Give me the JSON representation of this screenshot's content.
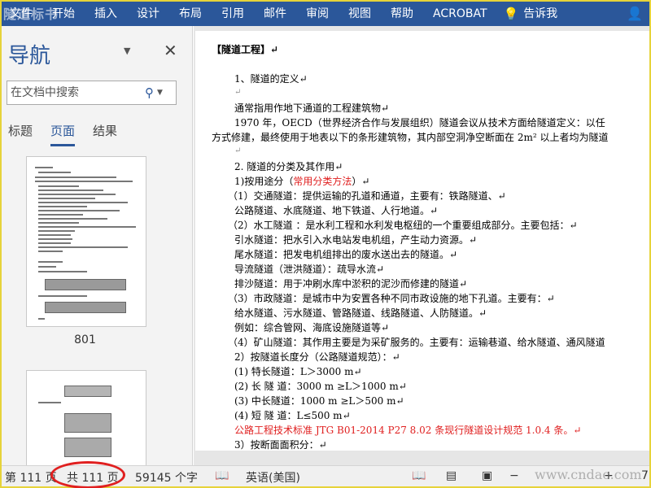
{
  "ribbon": {
    "tabs": [
      "文件",
      "开始",
      "插入",
      "设计",
      "布局",
      "引用",
      "邮件",
      "审阅",
      "视图",
      "帮助",
      "ACROBAT"
    ],
    "tell_me": "告诉我",
    "watermark": "隧道标书"
  },
  "nav": {
    "title": "导航",
    "search_placeholder": "在文档中搜索",
    "tabs": [
      "标题",
      "页面",
      "结果"
    ],
    "active_tab": "页面",
    "thumb_label": "801"
  },
  "document": {
    "lines": [
      "【隧道工程】↵",
      "1、隧道的定义↵",
      "↵",
      "通常指用作地下通道的工程建筑物↵",
      "1970 年，OECD（世界经济合作与发展组织）隧道会议从技术方面给隧道定义：以任",
      "方式修建，最终使用于地表以下的条形建筑物，其内部空洞净空断面在 2m² 以上者均为隧道",
      "↵",
      "2. 隧道的分类及其作用↵",
      "1)按用途分（",
      "常用分类方法",
      "）↵",
      "（1）交通隧道：提供运输的孔道和通道，主要有：铁路隧道、↵",
      "公路隧道、水底隧道、地下铁道、人行地道。↵",
      "（2）水工隧道 ：是水利工程和水利发电枢纽的一个重要组成部分。主要包括：↵",
      "引水隧道：把水引入水电站发电机组，产生动力资源。↵",
      "尾水隧道：把发电机组排出的废水送出去的隧道。↵",
      "导流隧道（泄洪隧道）：疏导水流↵",
      "排沙隧道：用于冲刷水库中淤积的泥沙而修建的隧道↵",
      "（3）市政隧道：是城市中为安置各种不同市政设施的地下孔道。主要有：↵",
      "给水隧道、污水隧道、管路隧道、线路隧道、人防隧道。↵",
      "例如：综合管网、海底设施隧道等↵",
      "（4）矿山隧道：其作用主要是为采矿服务的。主要有：运输巷道、给水隧道、通风隧道",
      "2）按隧道长度分（公路隧道规范）：↵",
      "(1) 特长隧道：L＞3000 m↵",
      "(2) 长  隧  道：3000 m ≥L＞1000 m↵",
      "(3) 中长隧道：1000 m ≥L＞500 m↵",
      "(4) 短  隧  道：L≤500 m↵",
      "公路工程技术标准 JTG B01-2014 P27 8.02 条现行隧道设计规范 1.0.4 条。↵",
      "3）按断面面积分：↵"
    ]
  },
  "status": {
    "page": "第 111 页",
    "total": "共 111 页",
    "words": "59145 个字",
    "language": "英语(美国)",
    "zoom_partial": "7",
    "watermark": "www.cndao.com"
  },
  "colors": {
    "ribbon": "#2b579a",
    "highlight": "#e02020"
  }
}
